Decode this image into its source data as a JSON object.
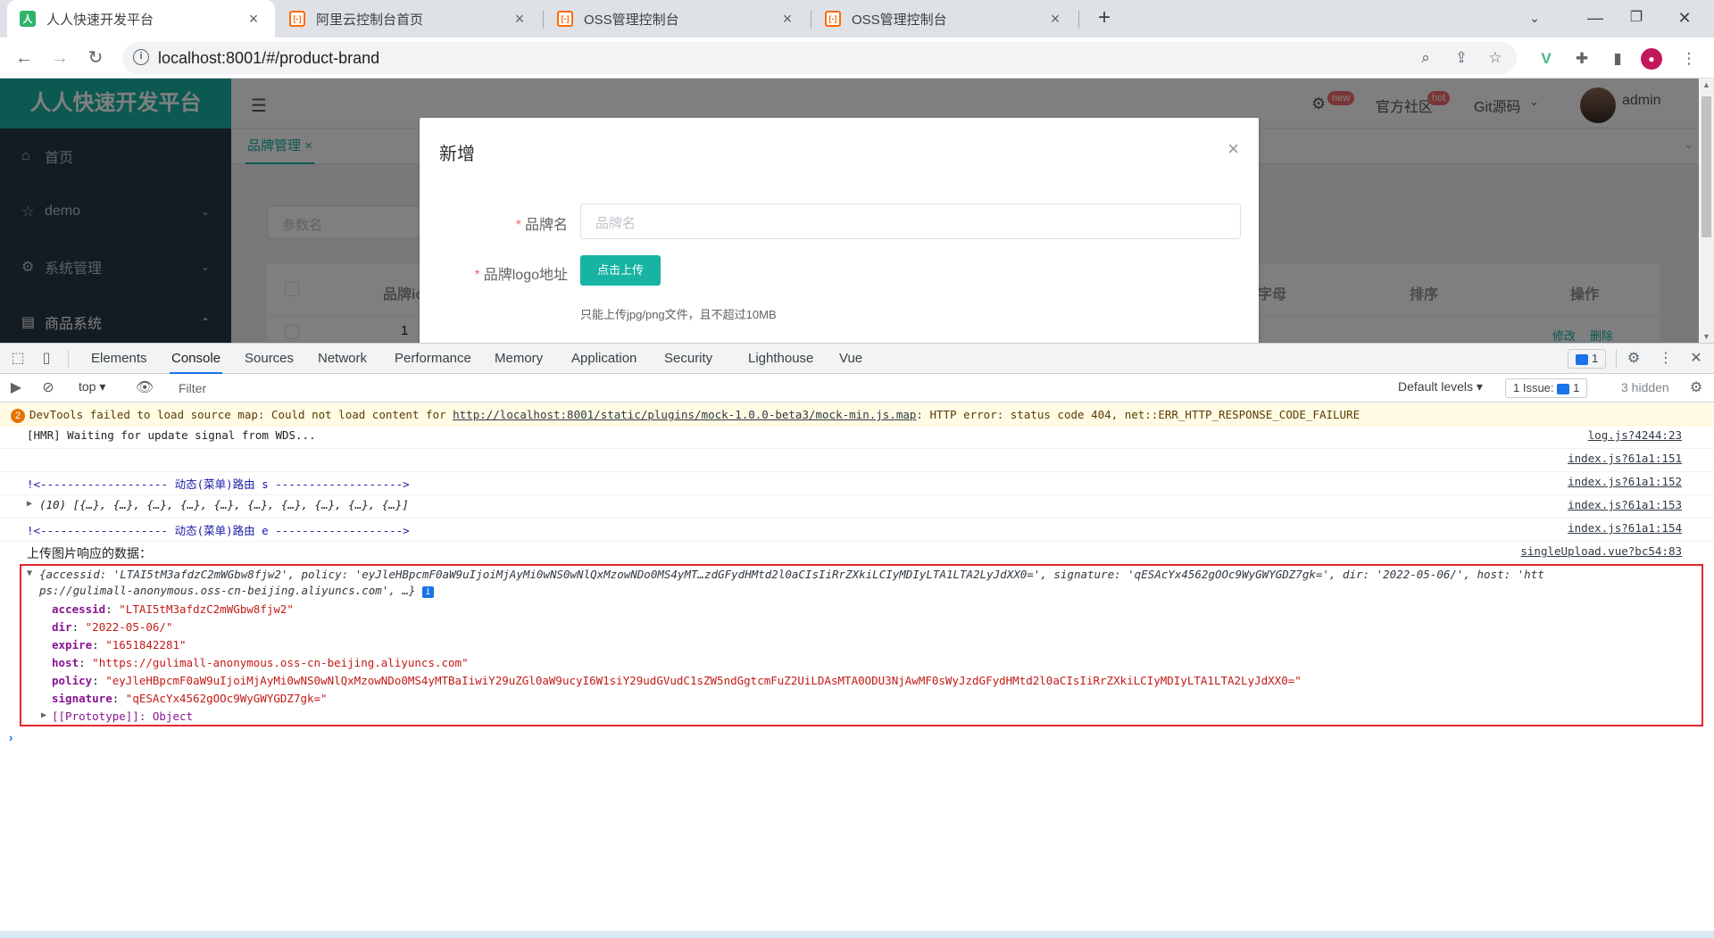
{
  "browser": {
    "tabs": [
      {
        "title": "人人快速开发平台",
        "favicon": "renren-icon",
        "active": true
      },
      {
        "title": "阿里云控制台首页",
        "favicon": "aliyun-icon",
        "active": false
      },
      {
        "title": "OSS管理控制台",
        "favicon": "aliyun-icon",
        "active": false
      },
      {
        "title": "OSS管理控制台",
        "favicon": "aliyun-icon",
        "active": false
      }
    ],
    "url": "localhost:8001/#/product-brand"
  },
  "app": {
    "logo": "人人快速开发平台",
    "menu": [
      {
        "label": "首页",
        "icon": "home-icon"
      },
      {
        "label": "demo",
        "icon": "star-icon"
      },
      {
        "label": "系统管理",
        "icon": "gear-icon"
      },
      {
        "label": "商品系统",
        "icon": "menu-icon"
      }
    ],
    "header": {
      "badge_new": "new",
      "community": "官方社区",
      "badge_hot": "hot",
      "git": "Git源码",
      "user": "admin"
    },
    "tab": "品牌管理",
    "search_placeholder": "参数名",
    "table_headers": [
      "品牌id",
      "字母",
      "排序",
      "操作"
    ],
    "row_id": "1",
    "row_actions": [
      "修改",
      "删除"
    ]
  },
  "dialog": {
    "title": "新增",
    "brand_name_label": "品牌名",
    "brand_name_placeholder": "品牌名",
    "logo_label": "品牌logo地址",
    "upload_button": "点击上传",
    "upload_tip": "只能上传jpg/png文件，且不超过10MB"
  },
  "devtools": {
    "tabs": [
      "Elements",
      "Console",
      "Sources",
      "Network",
      "Performance",
      "Memory",
      "Application",
      "Security",
      "Lighthouse",
      "Vue"
    ],
    "active_tab": "Console",
    "issues_count": "1",
    "context": "top",
    "filter_placeholder": "Filter",
    "levels": "Default levels",
    "issue_label": "1 Issue:",
    "issue_count": "1",
    "hidden": "3 hidden",
    "warning": {
      "count": "2",
      "text_prefix": "DevTools failed to load source map: Could not load content for ",
      "url": "http://localhost:8001/static/plugins/mock-1.0.0-beta3/mock-min.js.map",
      "text_suffix": ": HTTP error: status code 404, net::ERR_HTTP_RESPONSE_CODE_FAILURE"
    },
    "logs": [
      {
        "text": "[HMR] Waiting for update signal from WDS...",
        "source": "log.js?4244:23"
      },
      {
        "text": "",
        "source": "index.js?61a1:151"
      },
      {
        "text": "!<------------------- 动态(菜单)路由 s ------------------->",
        "source": "index.js?61a1:152"
      },
      {
        "text": "(10) [{…}, {…}, {…}, {…}, {…}, {…}, {…}, {…}, {…}, {…}]",
        "source": "index.js?61a1:153"
      },
      {
        "text": "!<------------------- 动态(菜单)路由 e ------------------->",
        "source": "index.js?61a1:154"
      },
      {
        "text": "上传图片响应的数据：",
        "source": "singleUpload.vue?bc54:83"
      }
    ],
    "object_summary_1": "{accessid: 'LTAI5tM3afdzC2mWGbw8fjw2', policy: 'eyJleHBpcmF0aW9uIjoiMjAyMi0wNS0wNlQxMzowNDo0MS4yMT…zdGFydHMtd2l0aCIsIiRrZXkiLCIyMDIyLTA1LTA2LyJdXX0=', signature: 'qESAcYx4562gOOc9WyGWYGDZ7gk=', dir: '2022-05-06/', host: 'htt",
    "object_summary_2": "ps://gulimall-anonymous.oss-cn-beijing.aliyuncs.com', …}",
    "object_props": [
      {
        "key": "accessid",
        "value": "\"LTAI5tM3afdzC2mWGbw8fjw2\""
      },
      {
        "key": "dir",
        "value": "\"2022-05-06/\""
      },
      {
        "key": "expire",
        "value": "\"1651842281\""
      },
      {
        "key": "host",
        "value": "\"https://gulimall-anonymous.oss-cn-beijing.aliyuncs.com\""
      },
      {
        "key": "policy",
        "value": "\"eyJleHBpcmF0aW9uIjoiMjAyMi0wNS0wNlQxMzowNDo0MS4yMTBaIiwiY29uZGl0aW9ucyI6W1siY29udGVudC1sZW5ndGgtcmFuZ2UiLDAsMTA0ODU3NjAwMF0sWyJzdGFydHMtd2l0aCIsIiRrZXkiLCIyMDIyLTA1LTA2LyJdXX0=\""
      },
      {
        "key": "signature",
        "value": "\"qESAcYx4562gOOc9WyGWYGDZ7gk=\""
      }
    ],
    "prototype": "[[Prototype]]: Object"
  }
}
